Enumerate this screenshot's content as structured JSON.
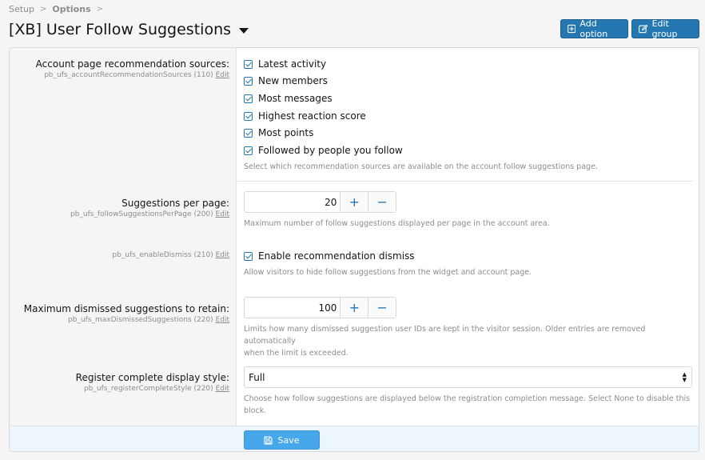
{
  "breadcrumb": {
    "items": [
      "Setup",
      "Options"
    ],
    "separator": ">"
  },
  "page_title": "[XB] User Follow Suggestions",
  "header_buttons": {
    "add_option": "Add option",
    "edit_group": "Edit group"
  },
  "options": {
    "sources": {
      "label": "Account page recommendation sources:",
      "meta": "pb_ufs_accountRecommendationSources (110)",
      "edit": "Edit",
      "checkboxes": [
        {
          "label": "Latest activity",
          "checked": true
        },
        {
          "label": "New members",
          "checked": true
        },
        {
          "label": "Most messages",
          "checked": true
        },
        {
          "label": "Highest reaction score",
          "checked": true
        },
        {
          "label": "Most points",
          "checked": true
        },
        {
          "label": "Followed by people you follow",
          "checked": true
        }
      ],
      "hint": "Select which recommendation sources are available on the account follow suggestions page."
    },
    "per_page": {
      "label": "Suggestions per page:",
      "meta": "pb_ufs_followSuggestionsPerPage (200)",
      "edit": "Edit",
      "value": "20",
      "plus": "+",
      "minus": "−",
      "hint": "Maximum number of follow suggestions displayed per page in the account area."
    },
    "dismiss": {
      "meta": "pb_ufs_enableDismiss (210)",
      "edit": "Edit",
      "checkbox_label": "Enable recommendation dismiss",
      "checked": true,
      "hint": "Allow visitors to hide follow suggestions from the widget and account page."
    },
    "max_dismissed": {
      "label": "Maximum dismissed suggestions to retain:",
      "meta": "pb_ufs_maxDismissedSuggestions (220)",
      "edit": "Edit",
      "value": "100",
      "plus": "+",
      "minus": "−",
      "hint_line1": "Limits how many dismissed suggestion user IDs are kept in the visitor session. Older entries are removed automatically",
      "hint_line2": "when the limit is exceeded."
    },
    "display_style": {
      "label": "Register complete display style:",
      "meta": "pb_ufs_registerCompleteStyle (220)",
      "edit": "Edit",
      "selected": "Full",
      "hint_line1": "Choose how follow suggestions are displayed below the registration completion message. Select None to disable this",
      "hint_line2": "block."
    }
  },
  "footer": {
    "save_label": "Save"
  },
  "colors": {
    "accent": "#2577b1",
    "save": "#47a7eb",
    "footer_bg": "#edf6fd"
  }
}
